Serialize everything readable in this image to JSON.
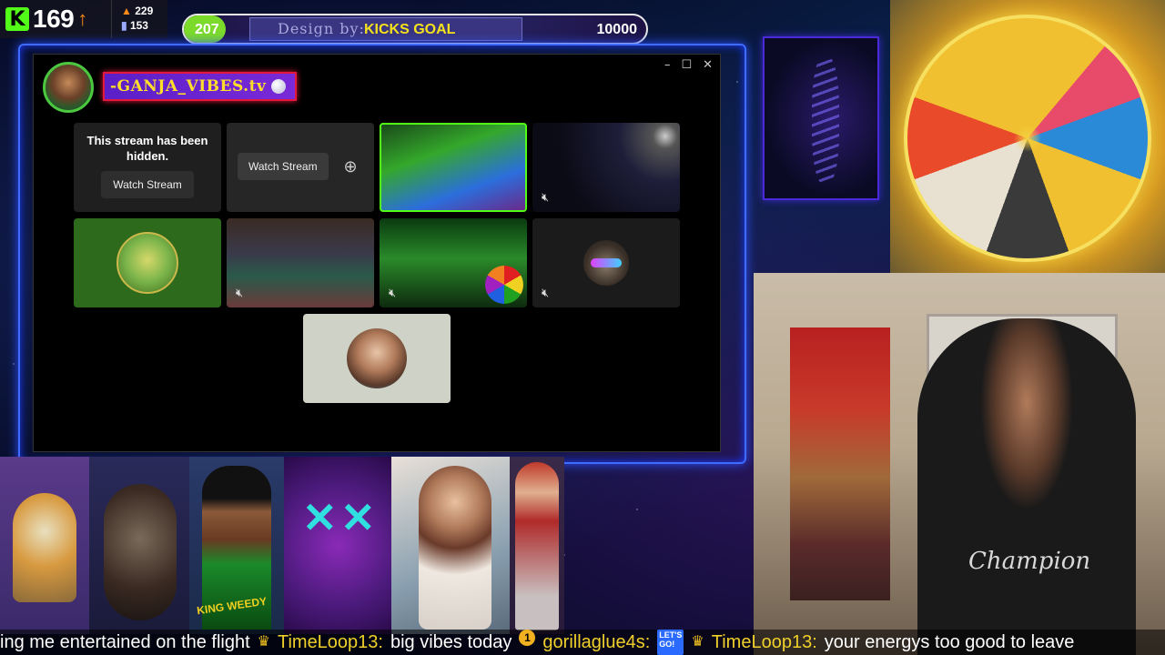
{
  "header": {
    "kick_viewers": "169",
    "stat_top": "229",
    "stat_bottom": "153"
  },
  "goal": {
    "current": "207",
    "design_by": "Design by:",
    "label": "KICKS GOAL",
    "target": "10000",
    "progress_fraction": 0.0207
  },
  "window": {
    "streamer_name": "-GANJA_VIBES.tv",
    "controls": [
      "–",
      "☐",
      "✕"
    ]
  },
  "tiles": {
    "hidden_message": "This stream has been hidden.",
    "hidden_button": "Watch Stream",
    "watch_button": "Watch Stream"
  },
  "gallery": {
    "weedy_label": "KING WEEDY"
  },
  "ticker": {
    "msg1_text": "ing me entertained on the flight",
    "msg2_user": "TimeLoop13:",
    "msg2_text": "big vibes today",
    "msg3_user": "gorillaglue4s:",
    "msg4_user": "TimeLoop13:",
    "msg4_text": "your energys too good to leave",
    "coin_badge": "1",
    "go_badge_line1": "LET'S",
    "go_badge_line2": "GO!"
  },
  "cam": {
    "shirt_text": "Champion"
  },
  "colors": {
    "kick_green": "#53fc18",
    "goal_text": "#f5e21a",
    "frame_blue": "#3f6bff",
    "badge_purple": "#5b1fc7"
  }
}
